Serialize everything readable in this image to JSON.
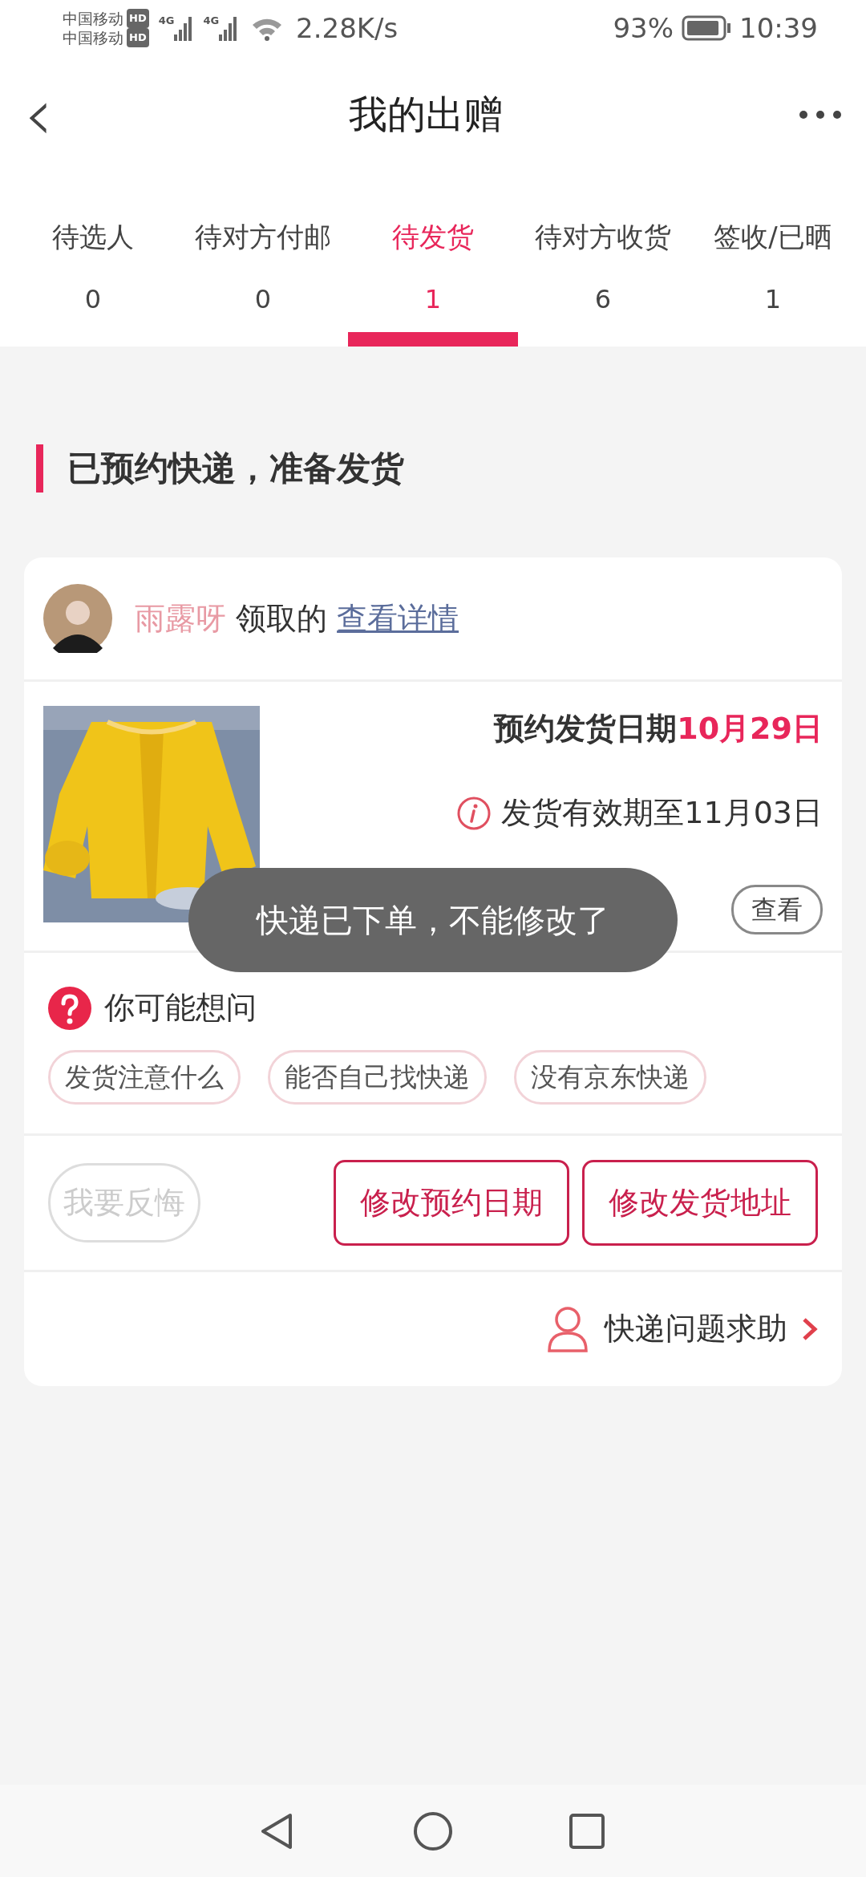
{
  "status_bar": {
    "carriers": [
      {
        "name": "中国移动",
        "badge": "HD",
        "network": "4G"
      },
      {
        "name": "中国移动",
        "badge": "HD",
        "network": "4G"
      }
    ],
    "speed": "2.28K/s",
    "battery": "93%",
    "time": "10:39"
  },
  "header": {
    "back": "‹",
    "title": "我的出赠"
  },
  "tabs": [
    {
      "label": "待选人",
      "count": "0",
      "selected": false
    },
    {
      "label": "待对方付邮",
      "count": "0",
      "selected": false
    },
    {
      "label": "待发货",
      "count": "1",
      "selected": true
    },
    {
      "label": "待对方收货",
      "count": "6",
      "selected": false
    },
    {
      "label": "签收/已晒",
      "count": "1",
      "selected": false
    }
  ],
  "section_title": "已预约快递，准备发货",
  "order": {
    "receiver": "雨露呀",
    "receiver_suffix": "领取的",
    "details_link": "查看详情",
    "ship_date_label": "预约发货日期",
    "ship_date": "10月29日",
    "validity": "发货有效期至11月03日",
    "view_button": "查看",
    "faq_title": "你可能想问",
    "faq_chips": [
      "发货注意什么",
      "能否自己找快递",
      "没有京东快递"
    ],
    "actions": [
      {
        "label": "我要反悔",
        "disabled": true
      },
      {
        "label": "修改预约日期",
        "disabled": false
      },
      {
        "label": "修改发货地址",
        "disabled": false
      }
    ],
    "help": "快递问题求助"
  },
  "toast": "快递已下单，不能修改了"
}
